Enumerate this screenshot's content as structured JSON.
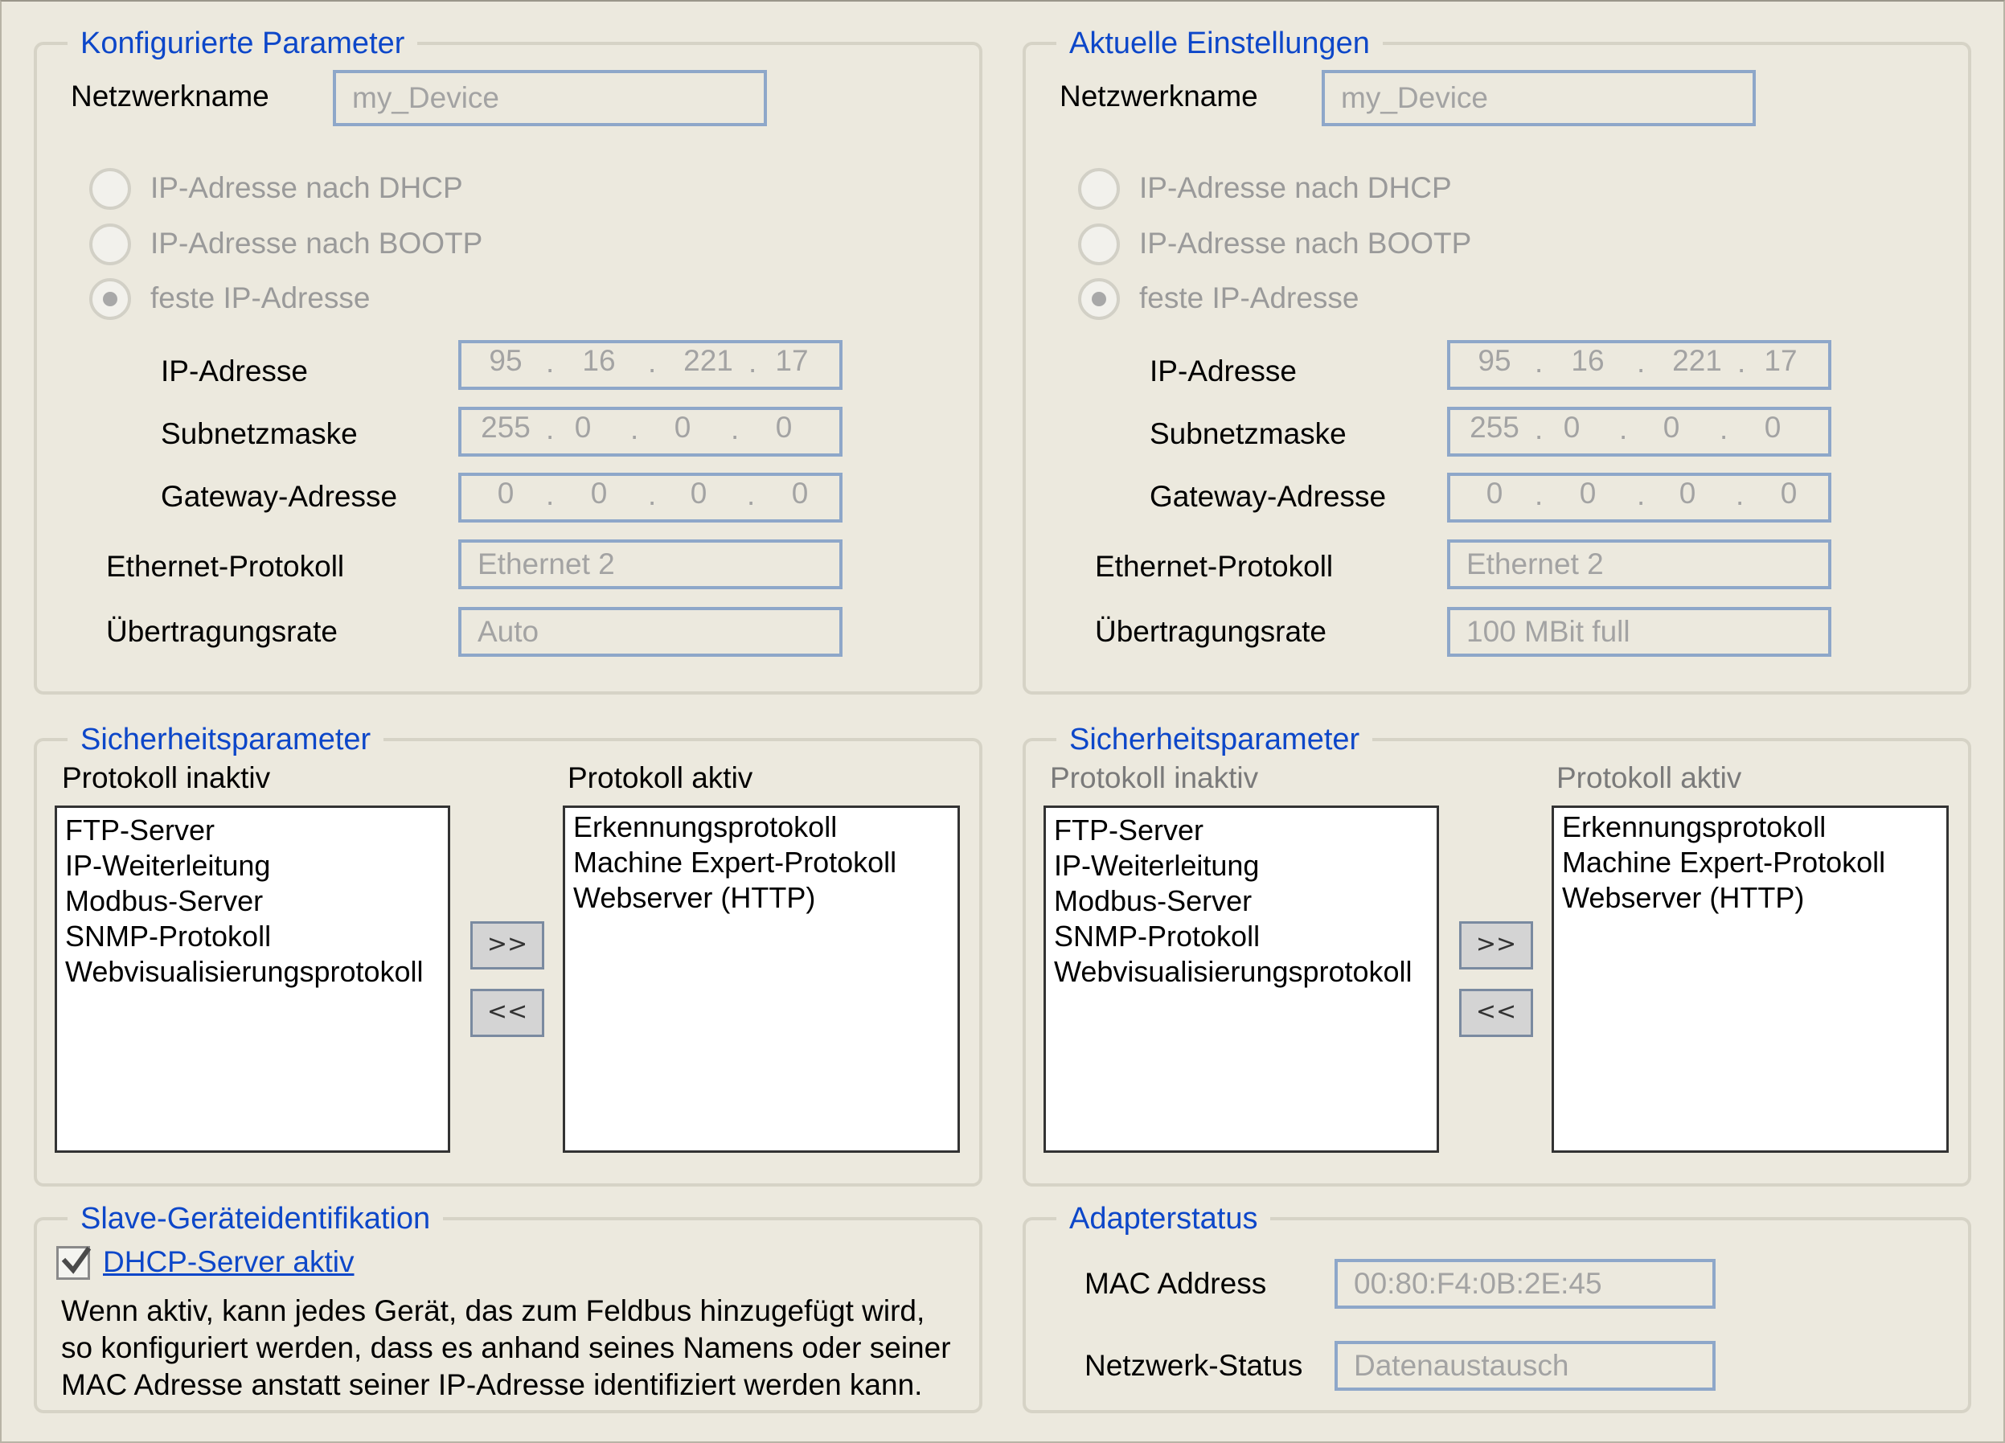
{
  "configured": {
    "title": "Konfigurierte Parameter",
    "network_name_label": "Netzwerkname",
    "network_name": "my_Device",
    "radio_dhcp": "IP-Adresse nach DHCP",
    "radio_bootp": "IP-Adresse nach BOOTP",
    "radio_fixed": "feste IP-Adresse",
    "selected_mode": "feste IP-Adresse",
    "ip_label": "IP-Adresse",
    "ip": [
      "95",
      "16",
      "221",
      "17"
    ],
    "subnet_label": "Subnetzmaske",
    "subnet": [
      "255",
      "0",
      "0",
      "0"
    ],
    "gateway_label": "Gateway-Adresse",
    "gateway": [
      "0",
      "0",
      "0",
      "0"
    ],
    "ethernet_label": "Ethernet-Protokoll",
    "ethernet": "Ethernet 2",
    "rate_label": "Übertragungsrate",
    "rate": "Auto"
  },
  "current": {
    "title": "Aktuelle Einstellungen",
    "network_name_label": "Netzwerkname",
    "network_name": "my_Device",
    "radio_dhcp": "IP-Adresse nach DHCP",
    "radio_bootp": "IP-Adresse nach BOOTP",
    "radio_fixed": "feste IP-Adresse",
    "selected_mode": "feste IP-Adresse",
    "ip_label": "IP-Adresse",
    "ip": [
      "95",
      "16",
      "221",
      "17"
    ],
    "subnet_label": "Subnetzmaske",
    "subnet": [
      "255",
      "0",
      "0",
      "0"
    ],
    "gateway_label": "Gateway-Adresse",
    "gateway": [
      "0",
      "0",
      "0",
      "0"
    ],
    "ethernet_label": "Ethernet-Protokoll",
    "ethernet": "Ethernet 2",
    "rate_label": "Übertragungsrate",
    "rate": "100 MBit full"
  },
  "security_left": {
    "title": "Sicherheitsparameter",
    "inactive_label": "Protokoll inaktiv",
    "active_label": "Protokoll aktiv",
    "inactive": [
      "FTP-Server",
      "IP-Weiterleitung",
      "Modbus-Server",
      "SNMP-Protokoll",
      "Webvisualisierungsprotokoll"
    ],
    "active": [
      "Erkennungsprotokoll",
      "Machine Expert-Protokoll",
      "Webserver (HTTP)"
    ],
    "move_right": ">>",
    "move_left": "<<"
  },
  "security_right": {
    "title": "Sicherheitsparameter",
    "inactive_label": "Protokoll inaktiv",
    "active_label": "Protokoll aktiv",
    "inactive": [
      "FTP-Server",
      "IP-Weiterleitung",
      "Modbus-Server",
      "SNMP-Protokoll",
      "Webvisualisierungsprotokoll"
    ],
    "active": [
      "Erkennungsprotokoll",
      "Machine Expert-Protokoll",
      "Webserver (HTTP)"
    ],
    "move_right": ">>",
    "move_left": "<<"
  },
  "slave": {
    "title": "Slave-Geräteidentifikation",
    "dhcp_server_label": "DHCP-Server aktiv",
    "dhcp_server_checked": true,
    "description_lines": [
      "Wenn aktiv, kann jedes Gerät, das zum Feldbus hinzugefügt wird,",
      "so konfiguriert werden, dass es anhand seines Namens oder seiner",
      "MAC Adresse anstatt seiner IP-Adresse identifiziert werden kann."
    ]
  },
  "adapter": {
    "title": "Adapterstatus",
    "mac_label": "MAC Address",
    "mac": "00:80:F4:0B:2E:45",
    "status_label": "Netzwerk-Status",
    "status": "Datenaustausch"
  },
  "colors": {
    "background": "#ece9de",
    "legend": "#0d47c9",
    "field_border": "#8ea7c9",
    "disabled_text": "#a3a3a3"
  },
  "icons": {
    "checkbox": "checkmark-icon",
    "radio": "radio-icon"
  }
}
